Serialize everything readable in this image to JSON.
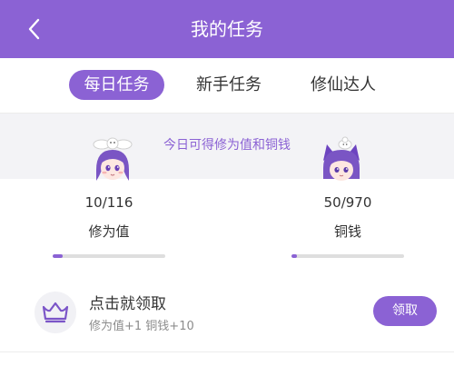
{
  "header": {
    "title": "我的任务"
  },
  "tabs": [
    {
      "label": "每日任务",
      "active": true
    },
    {
      "label": "新手任务",
      "active": false
    },
    {
      "label": "修仙达人",
      "active": false
    }
  ],
  "banner": {
    "text": "今日可得修为值和铜钱"
  },
  "stats": [
    {
      "value": "10/116",
      "label": "修为值",
      "progress": 0.086
    },
    {
      "value": "50/970",
      "label": "铜钱",
      "progress": 0.052
    }
  ],
  "tasks": [
    {
      "icon": "crown-icon",
      "title": "点击就领取",
      "reward": "修为值+1 铜钱+10",
      "button": "领取"
    }
  ],
  "colors": {
    "accent": "#8b62d4",
    "banner_bg": "#f3f3f6",
    "text": "#333333",
    "muted": "#8c8c8c"
  }
}
